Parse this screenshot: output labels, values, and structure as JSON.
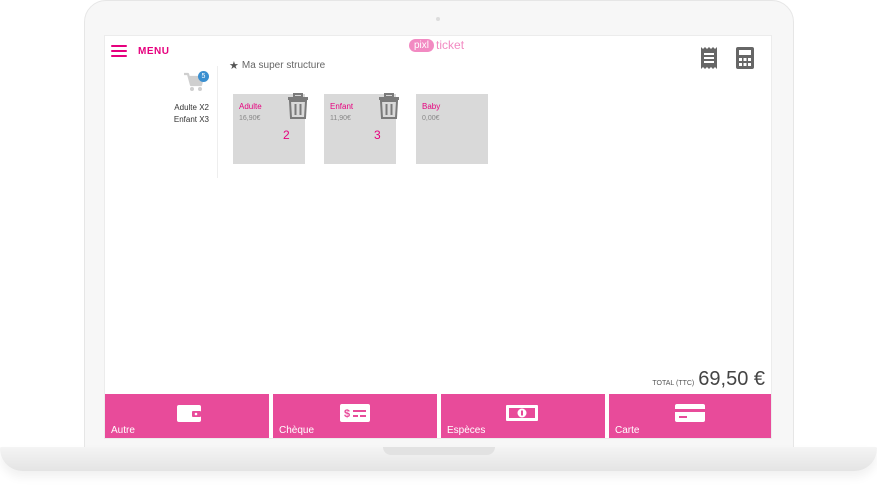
{
  "header": {
    "menu_label": "MENU",
    "logo_pill": "pixl",
    "logo_text": "ticket",
    "structure_name": "Ma super structure"
  },
  "cart": {
    "badge_count": "5",
    "lines": [
      "Adulte X2",
      "Enfant X3"
    ]
  },
  "products": [
    {
      "name": "Adulte",
      "price": "16,90€",
      "qty": "2"
    },
    {
      "name": "Enfant",
      "price": "11,90€",
      "qty": "3"
    },
    {
      "name": "Baby",
      "price": "0,00€",
      "qty": ""
    }
  ],
  "total": {
    "label": "TOTAL (TTC)",
    "value": "69,50 €"
  },
  "payments": [
    {
      "label": "Autre",
      "icon": "wallet-icon"
    },
    {
      "label": "Chèque",
      "icon": "cheque-icon"
    },
    {
      "label": "Espèces",
      "icon": "cash-icon"
    },
    {
      "label": "Carte",
      "icon": "credit-card-icon"
    }
  ],
  "colors": {
    "accent": "#e6007e",
    "payment_bar": "#e84b9a",
    "tile_bg": "#d9d9d9",
    "badge": "#3a8fd0"
  }
}
